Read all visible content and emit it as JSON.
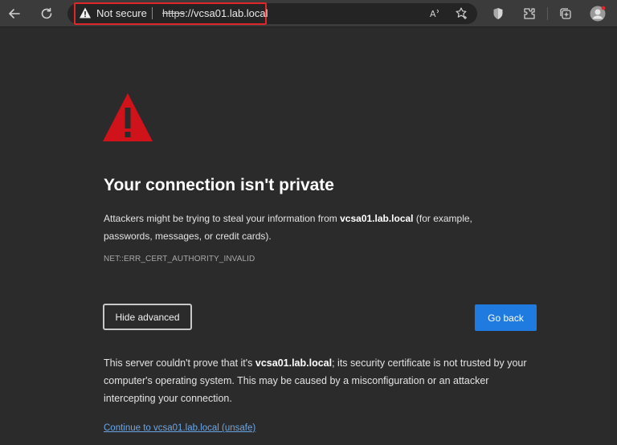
{
  "toolbar": {
    "back_icon": "back-arrow-icon",
    "refresh_icon": "refresh-icon",
    "security_label": "Not secure",
    "url_scheme": "https",
    "url_rest": "://vcsa01.lab.local",
    "read_aloud_icon": "read-aloud-icon",
    "favorite_icon": "favorite-star-icon",
    "shield_icon": "shield-icon",
    "extensions_icon": "puzzle-icon",
    "collections_icon": "collections-icon",
    "profile_icon": "avatar"
  },
  "colors": {
    "accent": "#1f7be0",
    "danger": "#d0121b",
    "highlight": "#e0262b",
    "background": "#2b2b2b"
  },
  "page": {
    "title": "Your connection isn't private",
    "desc_prefix": "Attackers might be trying to steal your information from ",
    "desc_host": "vcsa01.lab.local",
    "desc_suffix": " (for example, passwords, messages, or credit cards).",
    "error_code": "NET::ERR_CERT_AUTHORITY_INVALID",
    "hide_advanced_label": "Hide advanced",
    "go_back_label": "Go back",
    "details_prefix": "This server couldn't prove that it's ",
    "details_host": "vcsa01.lab.local",
    "details_suffix": "; its security certificate is not trusted by your computer's operating system. This may be caused by a misconfiguration or an attacker intercepting your connection.",
    "proceed_link": "Continue to vcsa01.lab.local (unsafe)"
  }
}
